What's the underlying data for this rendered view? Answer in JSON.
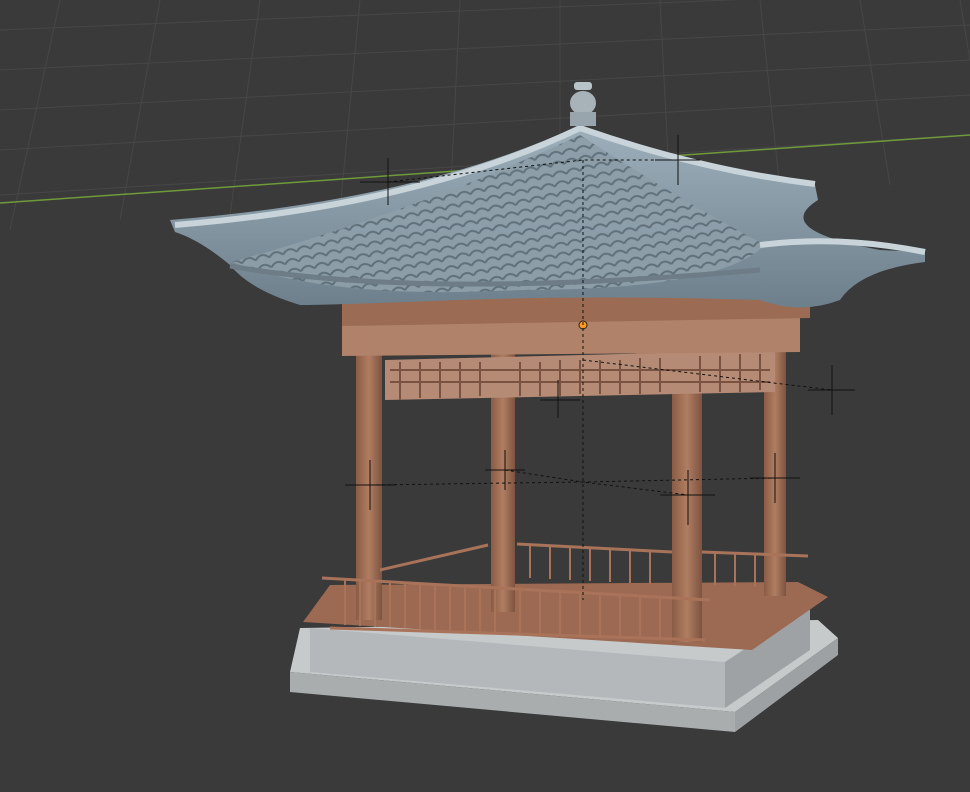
{
  "viewport": {
    "background": "#3a3a3a",
    "grid_color": "#4a4a4a",
    "x_axis_color": "#6f9a3a"
  },
  "model": {
    "name": "pavilion-model",
    "roof_color": "#8fa1ad",
    "roof_edge_color": "#b9c7ce",
    "wood_color": "#a06f56",
    "base_color": "#b9bdbf",
    "origin_color": "#ff9a1a"
  },
  "icons": [
    "empty-cross-icon",
    "origin-dot-icon"
  ]
}
